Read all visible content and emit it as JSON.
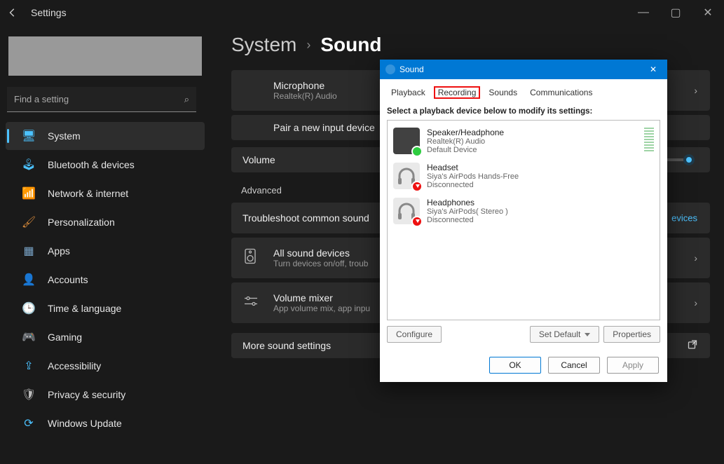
{
  "window": {
    "title": "Settings",
    "controls": {
      "min": "—",
      "max": "▢",
      "close": "✕"
    }
  },
  "search": {
    "placeholder": "Find a setting",
    "icon": "⌕"
  },
  "sidebar": {
    "items": [
      {
        "icon": "🖥",
        "label": "System",
        "active": true,
        "color": "#4cc2ff"
      },
      {
        "icon": "🕹",
        "label": "Bluetooth & devices",
        "color": "#4cc2ff"
      },
      {
        "icon": "📶",
        "label": "Network & internet",
        "color": "#4cc2ff"
      },
      {
        "icon": "🖌",
        "label": "Personalization",
        "color": "#d88a3a"
      },
      {
        "icon": "▦",
        "label": "Apps",
        "color": "#7aa5c9"
      },
      {
        "icon": "👤",
        "label": "Accounts",
        "color": "#6cc06c"
      },
      {
        "icon": "🕒",
        "label": "Time & language",
        "color": "#bbb"
      },
      {
        "icon": "🎮",
        "label": "Gaming",
        "color": "#bbb"
      },
      {
        "icon": "⇪",
        "label": "Accessibility",
        "color": "#4cc2ff"
      },
      {
        "icon": "🛡",
        "label": "Privacy & security",
        "color": "#bbb"
      },
      {
        "icon": "⟳",
        "label": "Windows Update",
        "color": "#4cc2ff"
      }
    ]
  },
  "breadcrumb": {
    "parent": "System",
    "sep": "›",
    "current": "Sound"
  },
  "main": {
    "mic": {
      "title": "Microphone",
      "sub": "Realtek(R) Audio"
    },
    "pair": {
      "title": "Pair a new input device"
    },
    "volume": {
      "title": "Volume"
    },
    "advanced_head": "Advanced",
    "troubleshoot": {
      "title": "Troubleshoot common sound",
      "link": "evices"
    },
    "all_devices": {
      "title": "All sound devices",
      "sub": "Turn devices on/off, troub"
    },
    "mixer": {
      "title": "Volume mixer",
      "sub": "App volume mix, app inpu"
    },
    "more": {
      "title": "More sound settings"
    }
  },
  "dialog": {
    "title": "Sound",
    "tabs": [
      "Playback",
      "Recording",
      "Sounds",
      "Communications"
    ],
    "highlighted_tab_index": 1,
    "instruction": "Select a playback device below to modify its settings:",
    "devices": [
      {
        "name": "Speaker/Headphone",
        "line2": "Realtek(R) Audio",
        "line3": "Default Device",
        "status": "ok",
        "icon": "speaker"
      },
      {
        "name": "Headset",
        "line2": "Siya's AirPods Hands-Free",
        "line3": "Disconnected",
        "status": "down",
        "icon": "headset"
      },
      {
        "name": "Headphones",
        "line2": "Siya's AirPods( Stereo )",
        "line3": "Disconnected",
        "status": "down",
        "icon": "headphones"
      }
    ],
    "buttons": {
      "configure": "Configure",
      "set_default": "Set Default",
      "properties": "Properties"
    },
    "footer": {
      "ok": "OK",
      "cancel": "Cancel",
      "apply": "Apply"
    }
  }
}
